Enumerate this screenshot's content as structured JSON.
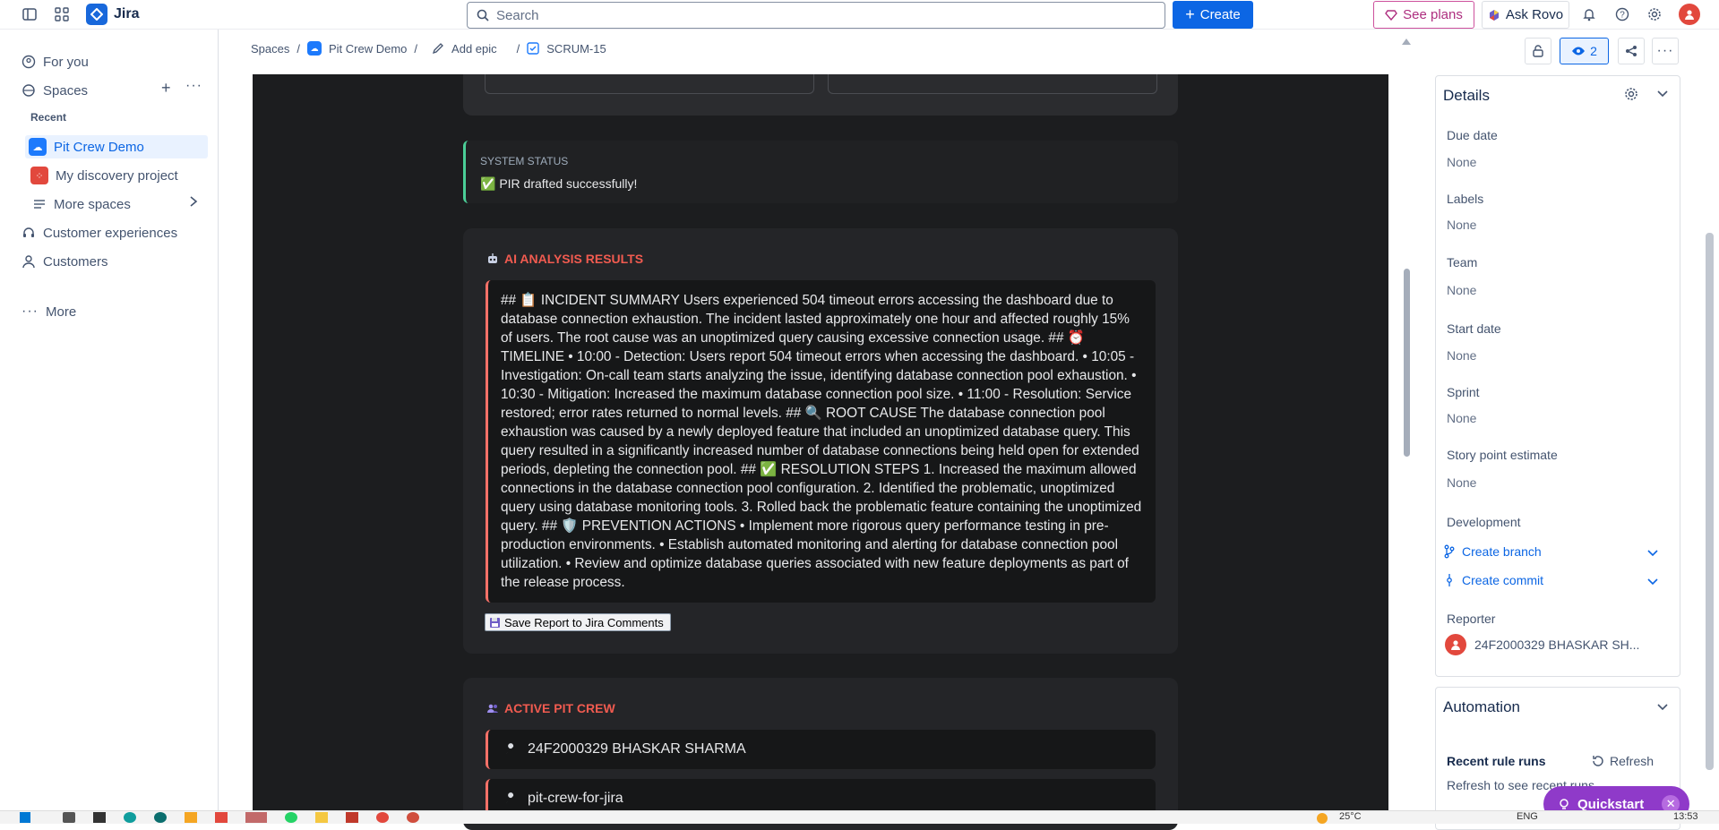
{
  "app": {
    "title": "Jira"
  },
  "topbar": {
    "search_placeholder": "Search",
    "create_label": "Create",
    "see_plans_label": "See plans",
    "ask_rovo_label": "Ask Rovo"
  },
  "sidebar": {
    "for_you": "For you",
    "spaces": "Spaces",
    "recent_heading": "Recent",
    "items": [
      {
        "label": "Pit Crew Demo",
        "active": true
      },
      {
        "label": "My discovery project",
        "active": false
      },
      {
        "label": "More spaces",
        "active": false
      }
    ],
    "customer_experiences": "Customer experiences",
    "customers": "Customers",
    "more": "More"
  },
  "breadcrumb": {
    "spaces": "Spaces",
    "project": "Pit Crew Demo",
    "add_epic": "Add epic",
    "issue_key": "SCRUM-15"
  },
  "issue_actions": {
    "watch_count": "2"
  },
  "content": {
    "system_status_heading": "SYSTEM STATUS",
    "system_status_message": "✅ PIR drafted successfully!",
    "ai_heading": "AI ANALYSIS RESULTS",
    "ai_report": "## 📋 INCIDENT SUMMARY Users experienced 504 timeout errors accessing the dashboard due to database connection exhaustion. The incident lasted approximately one hour and affected roughly 15% of users. The root cause was an unoptimized query causing excessive connection usage. ## ⏰ TIMELINE • 10:00 - Detection: Users report 504 timeout errors when accessing the dashboard. • 10:05 - Investigation: On-call team starts analyzing the issue, identifying database connection pool exhaustion. • 10:30 - Mitigation: Increased the maximum database connection pool size. • 11:00 - Resolution: Service restored; error rates returned to normal levels. ## 🔍 ROOT CAUSE The database connection pool exhaustion was caused by a newly deployed feature that included an unoptimized database query. This query resulted in a significantly increased number of database connections being held open for extended periods, depleting the connection pool. ## ✅ RESOLUTION STEPS 1. Increased the maximum allowed connections in the database connection pool configuration. 2. Identified the problematic, unoptimized query using database monitoring tools. 3. Rolled back the problematic feature containing the unoptimized query. ## 🛡️ PREVENTION ACTIONS • Implement more rigorous query performance testing in pre-production environments. • Establish automated monitoring and alerting for database connection pool utilization. • Review and optimize database queries associated with new feature deployments as part of the release process.",
    "save_button": "Save Report to Jira Comments",
    "crew_heading": "ACTIVE PIT CREW",
    "crew": [
      "24F2000329 BHASKAR SHARMA",
      "pit-crew-for-jira"
    ]
  },
  "details": {
    "heading": "Details",
    "fields": [
      {
        "label": "Due date",
        "value": "None"
      },
      {
        "label": "Labels",
        "value": "None"
      },
      {
        "label": "Team",
        "value": "None"
      },
      {
        "label": "Start date",
        "value": "None"
      },
      {
        "label": "Sprint",
        "value": "None"
      },
      {
        "label": "Story point estimate",
        "value": "None"
      }
    ],
    "development_label": "Development",
    "create_branch": "Create branch",
    "create_commit": "Create commit",
    "reporter_label": "Reporter",
    "reporter_name": "24F2000329 BHASKAR SH..."
  },
  "automation": {
    "heading": "Automation",
    "recent_rule_runs": "Recent rule runs",
    "refresh": "Refresh",
    "refresh_hint": "Refresh to see recent runs"
  },
  "quickstart": {
    "label": "Quickstart"
  },
  "taskbar": {
    "temperature": "25°C",
    "lang": "ENG",
    "time": "13:53"
  },
  "colors": {
    "accent": "#0c66e4",
    "dark_bg": "#1c1d1f",
    "alert_red": "#f87168",
    "success": "#4bce97"
  }
}
